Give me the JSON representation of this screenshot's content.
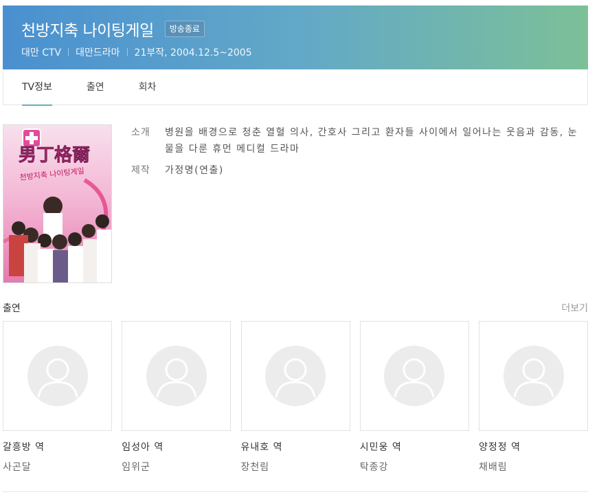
{
  "header": {
    "title": "천방지축 나이팅게일",
    "badge": "방송종료",
    "meta": [
      "대만 CTV",
      "대만드라마",
      "21부작, 2004.12.5~2005"
    ],
    "gradient_colors": [
      "#4a90d0",
      "#7cc098"
    ]
  },
  "tabs": [
    {
      "label": "TV정보",
      "active": true
    },
    {
      "label": "출연",
      "active": false
    },
    {
      "label": "회차",
      "active": false
    }
  ],
  "poster": {
    "title_text": "男丁格爾",
    "subtitle_text": "천방지축 나이팅게일"
  },
  "info": {
    "intro_label": "소개",
    "intro_text": "병원을 배경으로 청춘 열혈 의사, 간호사 그리고 환자들 사이에서 일어나는 웃음과 감동, 눈물을 다룬 휴먼 메디컬 드라마",
    "production_label": "제작",
    "production_text": "가정명(연출)"
  },
  "cast": {
    "title": "출연",
    "more": "더보기",
    "items": [
      {
        "role": "갈흥방 역",
        "actor": "사곤달"
      },
      {
        "role": "임성아 역",
        "actor": "임위군"
      },
      {
        "role": "유내호 역",
        "actor": "장천림"
      },
      {
        "role": "시민웅 역",
        "actor": "탁종강"
      },
      {
        "role": "양정정 역",
        "actor": "채배림"
      }
    ]
  },
  "colors": {
    "tab_underline": "#6aaeb9",
    "placeholder_bg": "#ececec"
  }
}
